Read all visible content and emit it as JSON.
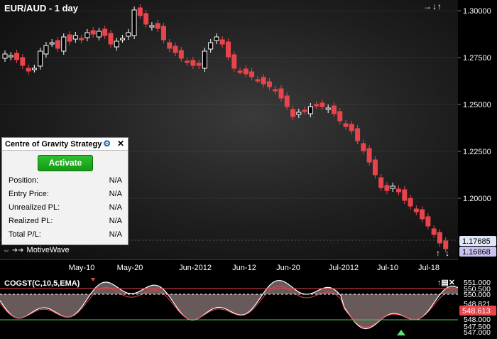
{
  "chart": {
    "title": "EUR/AUD - 1 day",
    "nav_right": "→↓↑",
    "price_labels": [
      "1.30000",
      "1.27500",
      "1.25000",
      "1.22500",
      "1.20000"
    ],
    "current_price_labels": [
      "1.17685",
      "1.16868"
    ],
    "time_labels": [
      "May-10",
      "May-20",
      "Jun-2012",
      "Jun-12",
      "Jun-20",
      "Jul-2012",
      "Jul-10",
      "Jul-18"
    ],
    "colors": {
      "up": "#ffffff",
      "down": "#e8444c",
      "axis_text": "#ffffff"
    }
  },
  "branding": {
    "logo_text": "MotiveWave"
  },
  "indicator": {
    "title": "COGST(C,10,5,EMA)",
    "icons": "↑▤✕",
    "axis_labels": [
      "551.000",
      "550.500",
      "550.000",
      "548.821",
      "548.000",
      "547.500",
      "547.000"
    ],
    "current_label": "548.613",
    "colors": {
      "fill": "#7a6a6a",
      "cog_line": "#ffffff",
      "signal_line": "#e8444c",
      "upper_band": "#e8444c",
      "lower_band": "#44cc44"
    }
  },
  "strategy": {
    "title": "Centre of Gravity Strategy",
    "activate_label": "Activate",
    "rows": [
      {
        "label": "Position:",
        "value": "N/A"
      },
      {
        "label": "Entry Price:",
        "value": "N/A"
      },
      {
        "label": "Unrealized PL:",
        "value": "N/A"
      },
      {
        "label": "Realized PL:",
        "value": "N/A"
      },
      {
        "label": "Total P/L:",
        "value": "N/A"
      }
    ]
  }
}
